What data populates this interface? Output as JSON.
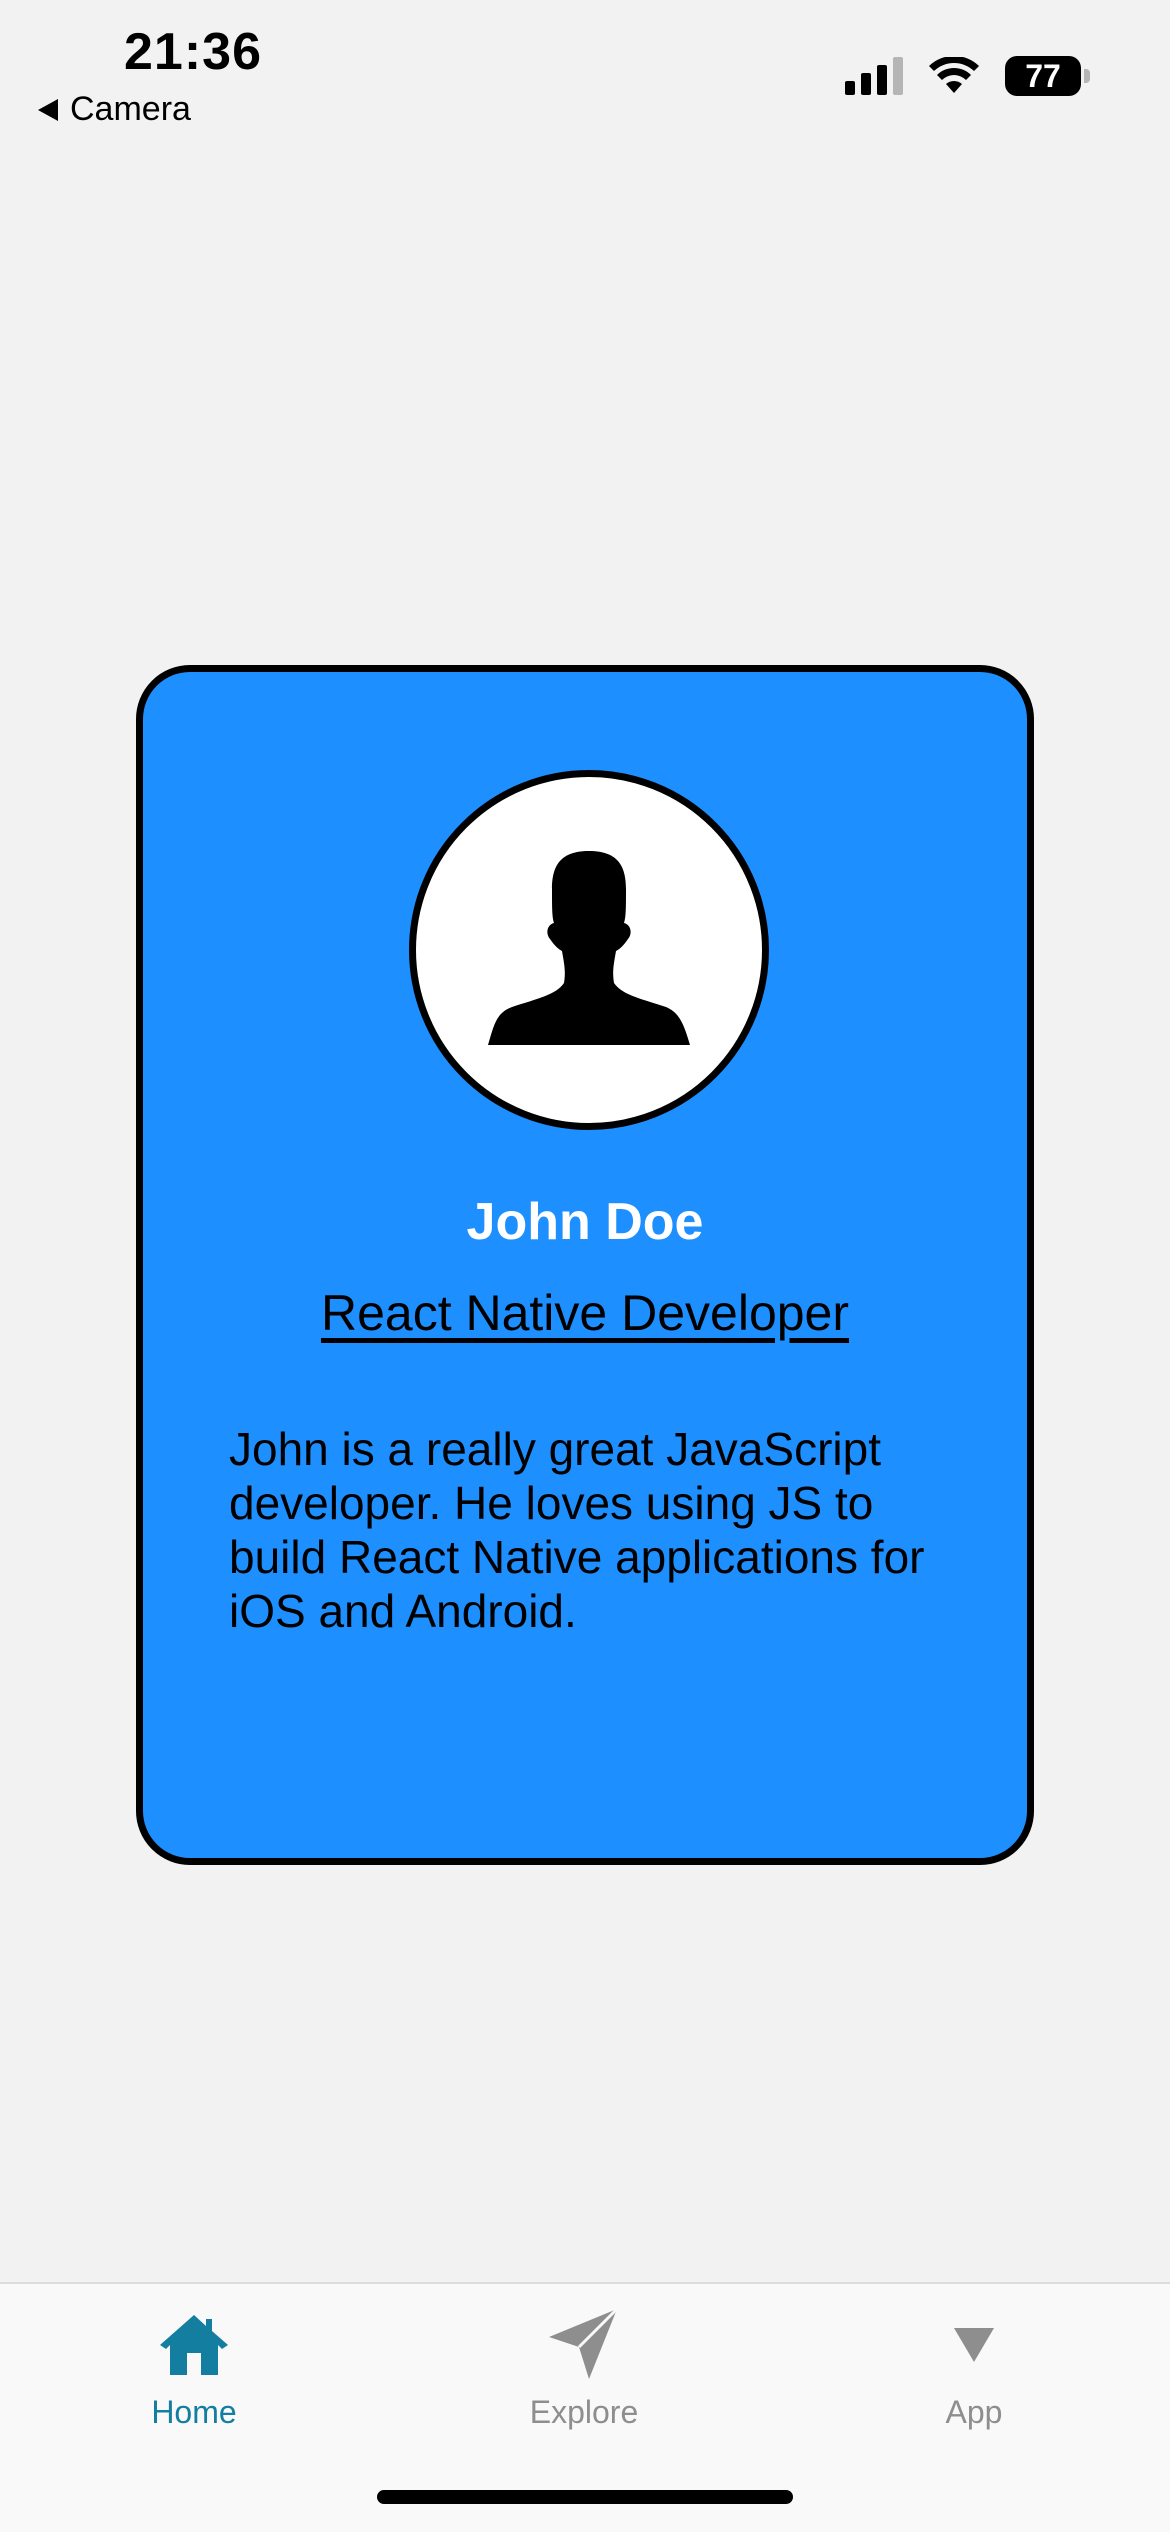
{
  "status_bar": {
    "time": "21:36",
    "back_label": "Camera",
    "battery": "77"
  },
  "card": {
    "name": "John Doe",
    "role": "React Native Developer",
    "bio": "John is a really great JavaScript developer. He loves using JS to build React Native applications for iOS and Android.",
    "background_color": "#1e8fff"
  },
  "tabs": [
    {
      "label": "Home",
      "icon": "home-icon",
      "active": true
    },
    {
      "label": "Explore",
      "icon": "paper-plane-icon",
      "active": false
    },
    {
      "label": "App",
      "icon": "triangle-down-icon",
      "active": false
    }
  ],
  "colors": {
    "active_tab": "#137ea0",
    "inactive_tab": "#8e8e8e"
  }
}
